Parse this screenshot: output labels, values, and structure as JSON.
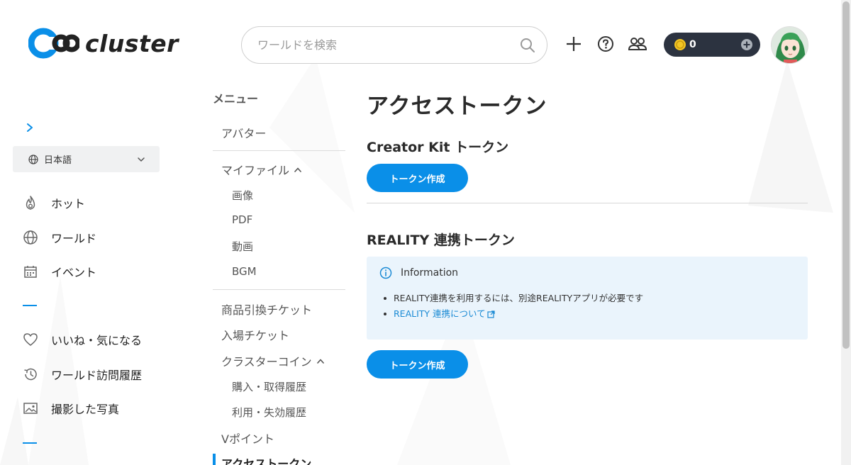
{
  "brand": {
    "name": "cluster",
    "accent": "#0a8fe8"
  },
  "header": {
    "search_placeholder": "ワールドを検索",
    "coins": "0"
  },
  "sidebar": {
    "language": "日本語",
    "items": [
      {
        "label": "ホット",
        "icon": "flame-icon"
      },
      {
        "label": "ワールド",
        "icon": "globe-icon"
      },
      {
        "label": "イベント",
        "icon": "calendar-icon"
      },
      {
        "label": "いいね・気になる",
        "icon": "heart-icon"
      },
      {
        "label": "ワールド訪問履歴",
        "icon": "history-icon"
      },
      {
        "label": "撮影した写真",
        "icon": "photo-icon"
      }
    ]
  },
  "menu": {
    "heading": "メニュー",
    "avatar": "アバター",
    "my_files": "マイファイル",
    "my_files_sub": [
      "画像",
      "PDF",
      "動画",
      "BGM"
    ],
    "voucher": "商品引換チケット",
    "ticket": "入場チケット",
    "coin": "クラスターコイン",
    "coin_sub": [
      "購入・取得履歴",
      "利用・失効履歴"
    ],
    "vpoint": "Vポイント",
    "access_token": "アクセストークン"
  },
  "main": {
    "title": "アクセストークン",
    "creator_kit_title": "Creator Kit トークン",
    "create_button": "トークン作成",
    "reality_title": "REALITY 連携トークン",
    "info_title": "Information",
    "info_items": [
      "REALITY連携を利用するには、別途REALITYアプリが必要です",
      "REALITY 連携について"
    ]
  }
}
